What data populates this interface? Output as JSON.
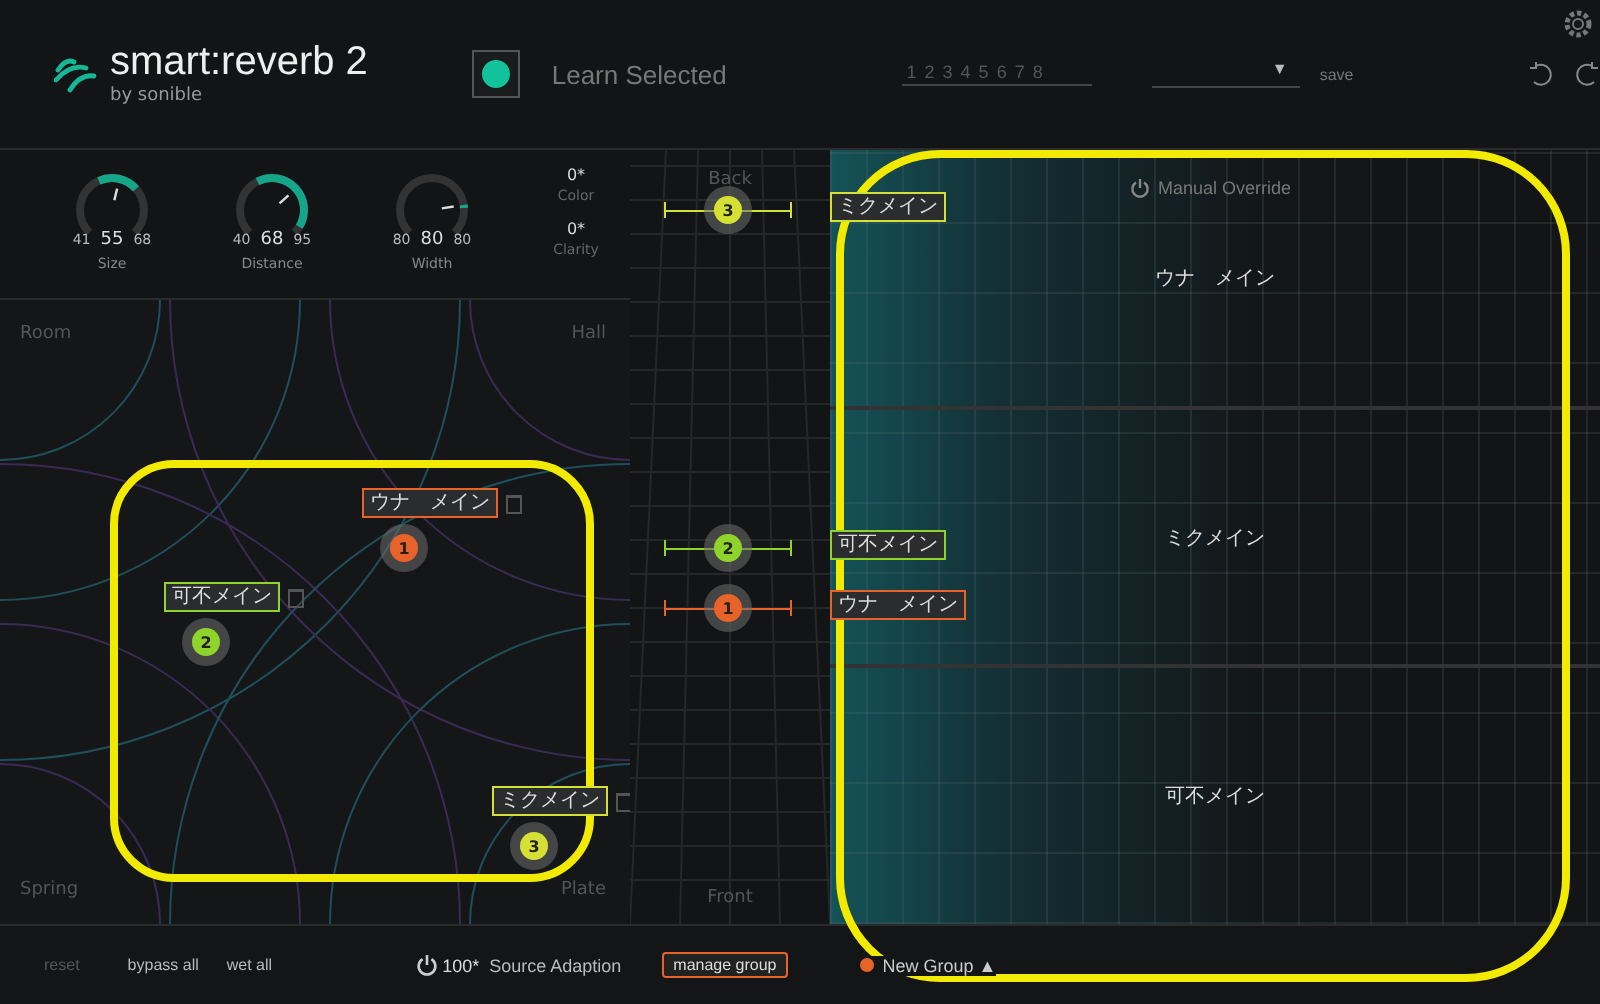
{
  "header": {
    "title": "smart:reverb 2",
    "byline": "by sonible",
    "learn": {
      "label": "Learn Selected",
      "on": true
    },
    "presets": [
      "1",
      "2",
      "3",
      "4",
      "5",
      "6",
      "7",
      "8"
    ],
    "dropdown_arrow": "▼",
    "save": "save"
  },
  "controls": {
    "knobs": [
      {
        "label": "Size",
        "min": "41",
        "value": "55",
        "max": "68",
        "level": 0.55
      },
      {
        "label": "Distance",
        "min": "40",
        "value": "68",
        "max": "95",
        "level": 0.68
      },
      {
        "label": "Width",
        "min": "80",
        "value": "80",
        "max": "80",
        "level": 0.8
      }
    ],
    "params": [
      {
        "value": "0*",
        "label": "Color"
      },
      {
        "value": "0*",
        "label": "Clarity"
      }
    ]
  },
  "placement": {
    "zones": [
      "Room",
      "Hall",
      "Spring",
      "Plate"
    ],
    "sources": [
      {
        "number": "1",
        "name": "ウナ　メイン",
        "color": "#e8632a"
      },
      {
        "number": "2",
        "name": "可不メイン",
        "color": "#8fd42a"
      },
      {
        "number": "3",
        "name": "ミクメイン",
        "color": "#d4e033"
      }
    ]
  },
  "depth": {
    "back": "Back",
    "front": "Front",
    "markers": [
      {
        "number": "3",
        "name": "ミクメイン",
        "color": "#d4e033"
      },
      {
        "number": "2",
        "name": "可不メイン",
        "color": "#8fd42a"
      },
      {
        "number": "1",
        "name": "ウナ　メイン",
        "color": "#e8632a"
      }
    ]
  },
  "spectrum": {
    "override": "Manual Override",
    "bands": [
      "ウナ　メイン",
      "ミクメイン",
      "可不メイン"
    ]
  },
  "footer": {
    "reset": {
      "label": "reset",
      "disabled": true
    },
    "bypass": "bypass all",
    "wet": "wet all",
    "adaption": {
      "value": "100*",
      "label": "Source Adaption"
    },
    "manage": "manage group",
    "new_group": {
      "label": "New Group",
      "arrow": "▲",
      "color": "#e8632a"
    }
  },
  "highlights": [
    {
      "kind": "outline"
    },
    {
      "kind": "outline"
    }
  ]
}
